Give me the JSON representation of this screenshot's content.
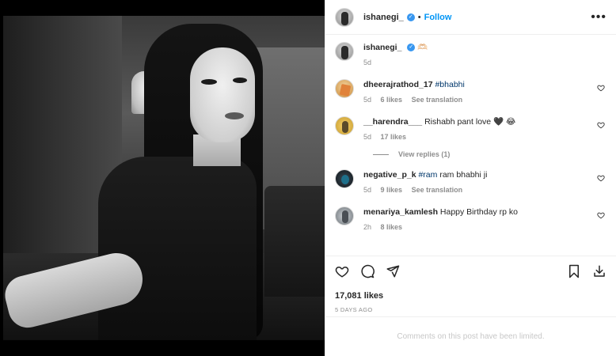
{
  "post": {
    "author": "ishanegi_",
    "follow_label": "Follow",
    "separator": "•",
    "more_label": "•••",
    "caption_emoji": "🫶🏻",
    "caption_time": "5d"
  },
  "comments": [
    {
      "user": "dheerajrathod_17",
      "hashtag": "#bhabhi",
      "text": "",
      "time": "5d",
      "likes": "6 likes",
      "action": "See translation"
    },
    {
      "user": "__harendra___",
      "hashtag": "",
      "text": "Rishabh pant love 🖤 😂",
      "time": "5d",
      "likes": "17 likes",
      "action": ""
    },
    {
      "user": "negative_p_k",
      "hashtag": "#ram",
      "text": "ram bhabhi ji",
      "time": "5d",
      "likes": "9 likes",
      "action": "See translation"
    },
    {
      "user": "menariya_kamlesh",
      "hashtag": "",
      "text": "Happy Birthday rp ko",
      "time": "2h",
      "likes": "8 likes",
      "action": ""
    }
  ],
  "view_replies": "View replies (1)",
  "stats": {
    "likes": "17,081 likes",
    "date": "5 DAYS AGO"
  },
  "limited_notice": "Comments on this post have been limited.",
  "icons": {
    "like": "heart-icon",
    "comment": "comment-icon",
    "share": "share-icon",
    "save": "bookmark-icon",
    "download": "download-icon",
    "verified": "verified-badge-icon"
  },
  "colors": {
    "accent": "#0095f6",
    "verified": "#3897f0",
    "muted": "#8e8e8e",
    "hashtag": "#00376b"
  }
}
